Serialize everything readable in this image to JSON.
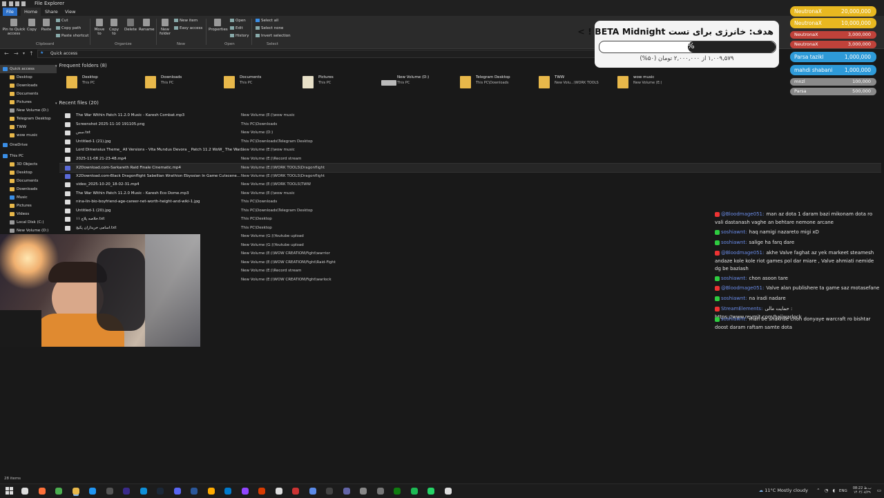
{
  "window": {
    "title": "File Explorer"
  },
  "ribbon": {
    "tabs": [
      "File",
      "Home",
      "Share",
      "View"
    ],
    "clipboard": {
      "pin": "Pin to Quick access",
      "copy": "Copy",
      "paste": "Paste",
      "cut": "Cut",
      "copy_path": "Copy path",
      "paste_shortcut": "Paste shortcut",
      "group": "Clipboard"
    },
    "organize": {
      "move": "Move to",
      "copy": "Copy to",
      "delete": "Delete",
      "rename": "Rename",
      "group": "Organize"
    },
    "new": {
      "new_folder": "New folder",
      "new_item": "New item",
      "easy_access": "Easy access",
      "group": "New"
    },
    "open": {
      "properties": "Properties",
      "open": "Open",
      "edit": "Edit",
      "history": "History",
      "group": "Open"
    },
    "select": {
      "all": "Select all",
      "none": "Select none",
      "invert": "Invert selection",
      "group": "Select"
    }
  },
  "address": {
    "path": "Quick access"
  },
  "sidebar": {
    "items": [
      {
        "label": "Quick access",
        "icon": "star-icon",
        "level": 0
      },
      {
        "label": "Desktop",
        "icon": "folder-icon",
        "level": 1
      },
      {
        "label": "Downloads",
        "icon": "folder-icon",
        "level": 1
      },
      {
        "label": "Documents",
        "icon": "folder-icon",
        "level": 1
      },
      {
        "label": "Pictures",
        "icon": "folder-icon",
        "level": 1
      },
      {
        "label": "New Volume (D:)",
        "icon": "drive-icon",
        "level": 1
      },
      {
        "label": "Telegram Desktop",
        "icon": "folder-icon",
        "level": 1
      },
      {
        "label": "TWW",
        "icon": "folder-icon",
        "level": 1
      },
      {
        "label": "wow music",
        "icon": "folder-icon",
        "level": 1
      },
      {
        "label": "OneDrive",
        "icon": "cloud-icon",
        "level": 0
      },
      {
        "label": "This PC",
        "icon": "pc-icon",
        "level": 0
      },
      {
        "label": "3D Objects",
        "icon": "folder-icon",
        "level": 1
      },
      {
        "label": "Desktop",
        "icon": "folder-icon",
        "level": 1
      },
      {
        "label": "Documents",
        "icon": "folder-icon",
        "level": 1
      },
      {
        "label": "Downloads",
        "icon": "folder-icon",
        "level": 1
      },
      {
        "label": "Music",
        "icon": "music-icon",
        "level": 1
      },
      {
        "label": "Pictures",
        "icon": "folder-icon",
        "level": 1
      },
      {
        "label": "Videos",
        "icon": "folder-icon",
        "level": 1
      },
      {
        "label": "Local Disk (C:)",
        "icon": "drive-icon",
        "level": 1
      },
      {
        "label": "New Volume (D:)",
        "icon": "drive-icon",
        "level": 1
      }
    ]
  },
  "frequent": {
    "header": "Frequent folders (8)",
    "items": [
      {
        "name": "Desktop",
        "sub": "This PC",
        "icon": "folder-icon"
      },
      {
        "name": "Downloads",
        "sub": "This PC",
        "icon": "folder-icon"
      },
      {
        "name": "Documents",
        "sub": "This PC",
        "icon": "folder-icon"
      },
      {
        "name": "Pictures",
        "sub": "This PC",
        "icon": "folder-icon"
      },
      {
        "name": "New Volume (D:)",
        "sub": "This PC",
        "icon": "drive-icon"
      },
      {
        "name": "Telegram Desktop",
        "sub": "This PC\\Downloads",
        "icon": "folder-icon"
      },
      {
        "name": "TWW",
        "sub": "New Volu...\\WORK TOOLS",
        "icon": "folder-icon"
      },
      {
        "name": "wow music",
        "sub": "New Volume (E:)",
        "icon": "folder-icon"
      }
    ]
  },
  "recent": {
    "header": "Recent files (20)",
    "items": [
      {
        "name": "The War Within Patch 11.2.0 Music - Karesh Combat.mp3",
        "path": "New Volume (E:)\\wow music"
      },
      {
        "name": "Screenshot 2025-11-10 191105.png",
        "path": "This PC\\Downloads"
      },
      {
        "name": "سس.txt",
        "path": "New Volume (D:)"
      },
      {
        "name": "Untitled-1 (21).jpg",
        "path": "This PC\\Downloads\\Telegram Desktop"
      },
      {
        "name": "Lord Dimensius Theme_ All Versions - Vita Mundus Devora _ Patch 11.2 WoW_ The War...",
        "path": "New Volume (E:)\\wow music"
      },
      {
        "name": "2025-11-08 21-23-48.mp4",
        "path": "New Volume (E:)\\Record stream"
      },
      {
        "name": "X2Download.com-Sarkareth Raid Finale Cinematic.mp4",
        "path": "New Volume (E:)\\WORK TOOLS\\Dragonflight"
      },
      {
        "name": "X2Download.com-Black Dragonflight Sabellian Wrathion Ebyssian In Game Cutscene...",
        "path": "New Volume (E:)\\WORK TOOLS\\Dragonflight"
      },
      {
        "name": "video_2025-10-20_18-02-31.mp4",
        "path": "New Volume (E:)\\WORK TOOLS\\TWW"
      },
      {
        "name": "The War Within Patch 11.2.0 Music - Karesh Eco Dome.mp3",
        "path": "New Volume (E:)\\wow music"
      },
      {
        "name": "nina-lin-bio-boyfriend-age-career-net-worth-height-and-wiki-1.jpg",
        "path": "This PC\\Downloads"
      },
      {
        "name": "Untitled-1 (20).jpg",
        "path": "This PC\\Downloads\\Telegram Desktop"
      },
      {
        "name": "خلاصه پلاچ ۱۱.txt",
        "path": "This PC\\Desktop"
      },
      {
        "name": "اسامی خریداران پکیج.txt",
        "path": "This PC\\Desktop"
      },
      {
        "name": "",
        "path": "New Volume (G:)\\Youtube upload"
      },
      {
        "name": "",
        "path": "New Volume (G:)\\Youtube upload"
      },
      {
        "name": "",
        "path": "New Volume (E:)\\WOW CREATION\\Fight\\warrior"
      },
      {
        "name": "",
        "path": "New Volume (E:)\\WOW CREATION\\Fight\\Raid-Fight"
      },
      {
        "name": "",
        "path": "New Volume (E:)\\Record stream"
      },
      {
        "name": "",
        "path": "New Volume (E:)\\WOW CREATION\\Fight\\warlock"
      }
    ]
  },
  "status": {
    "items": "28 items"
  },
  "goal": {
    "title": "هدف: خانرژی برای تست BETA Midnight ! >",
    "percent": "۵۰%",
    "progress": 0.5,
    "subtitle": "۱,۰۰۹,۵۷۹ از ۲,۰۰۰,۰۰۰ تومان (۵۰%)"
  },
  "donations": [
    {
      "name": "NeutronaX",
      "amount": "20,000,000",
      "color": "#e8b820"
    },
    {
      "name": "NeutronaX",
      "amount": "10,000,000",
      "color": "#e8b820"
    },
    {
      "name": "NeutronaX",
      "amount": "3,000,000",
      "color": "#c0423a"
    },
    {
      "name": "NeutronaX",
      "amount": "3,000,000",
      "color": "#c0423a"
    },
    {
      "name": "Parsa tazikl",
      "amount": "1,000,000",
      "color": "#2e9ad8"
    },
    {
      "name": "mahdi shabani",
      "amount": "1,000,000",
      "color": "#2e9ad8"
    },
    {
      "name": "mnzl",
      "amount": "100,000",
      "color": "#8a8a8a"
    },
    {
      "name": "Parsa",
      "amount": "500,000",
      "color": "#8a8a8a"
    }
  ],
  "chat": [
    {
      "user": "@Bloodmage051:",
      "badge": "red",
      "text": "man az dota 1 daram bazi mikonam dota ro vali dastanash vaghe an behtare nemone arcane"
    },
    {
      "user": "soshiawnt:",
      "badge": "green",
      "text": "haq namigi nazareto migi xD"
    },
    {
      "user": "soshiawnt:",
      "badge": "green",
      "text": "salige ha farq dare"
    },
    {
      "user": "@Bloodmage051:",
      "badge": "red",
      "text": "akhe Valve faghat az yek markeet steamesh andaze kole kole riot games pol dar miare , Valve ahmiati nemide dg be baziash"
    },
    {
      "user": "soshiawnt:",
      "badge": "green",
      "text": "chon asoon tare"
    },
    {
      "user": "@Bloodmage051:",
      "badge": "red",
      "text": "Valve alan publishere ta game saz motasefane"
    },
    {
      "user": "soshiawnt:",
      "badge": "green",
      "text": "na iradi nadare"
    },
    {
      "user": "StreamElements:",
      "badge": "red",
      "text": "حمایت مالی : https://www.reymit.com/hajiwarlock"
    },
    {
      "user": "soshiawnt:",
      "badge": "green",
      "text": "man be shakhse chon donyaye warcraft ro bishtar doost daram raftam samte dota"
    }
  ],
  "taskbar": {
    "weather": "11°C  Mostly cloudy",
    "lang": "ENG",
    "time": "08:22 ب.ظ",
    "date": "۱۴۰۴/۰۸/۲۹"
  }
}
